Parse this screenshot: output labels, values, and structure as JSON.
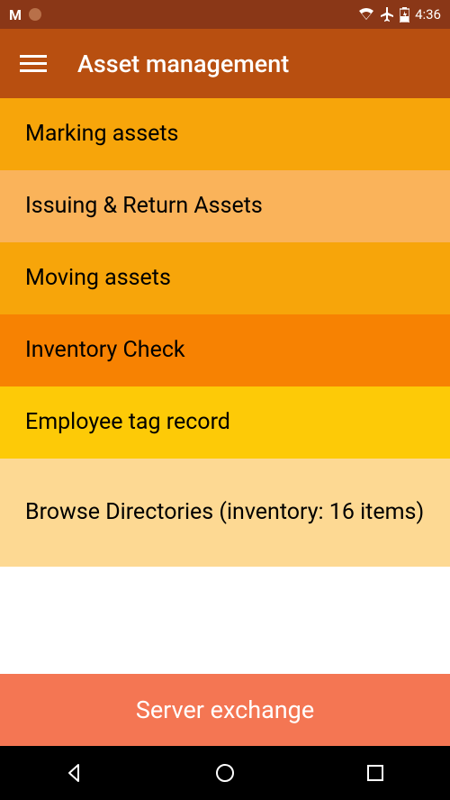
{
  "status_bar": {
    "time": "4:36"
  },
  "app_bar": {
    "title": "Asset management"
  },
  "menu": {
    "items": [
      {
        "label": "Marking assets"
      },
      {
        "label": "Issuing & Return Assets"
      },
      {
        "label": "Moving assets"
      },
      {
        "label": "Inventory Check"
      },
      {
        "label": "Employee tag record"
      },
      {
        "label": "Browse Directories (inventory: 16 items)"
      }
    ]
  },
  "bottom_action": {
    "label": "Server exchange"
  }
}
